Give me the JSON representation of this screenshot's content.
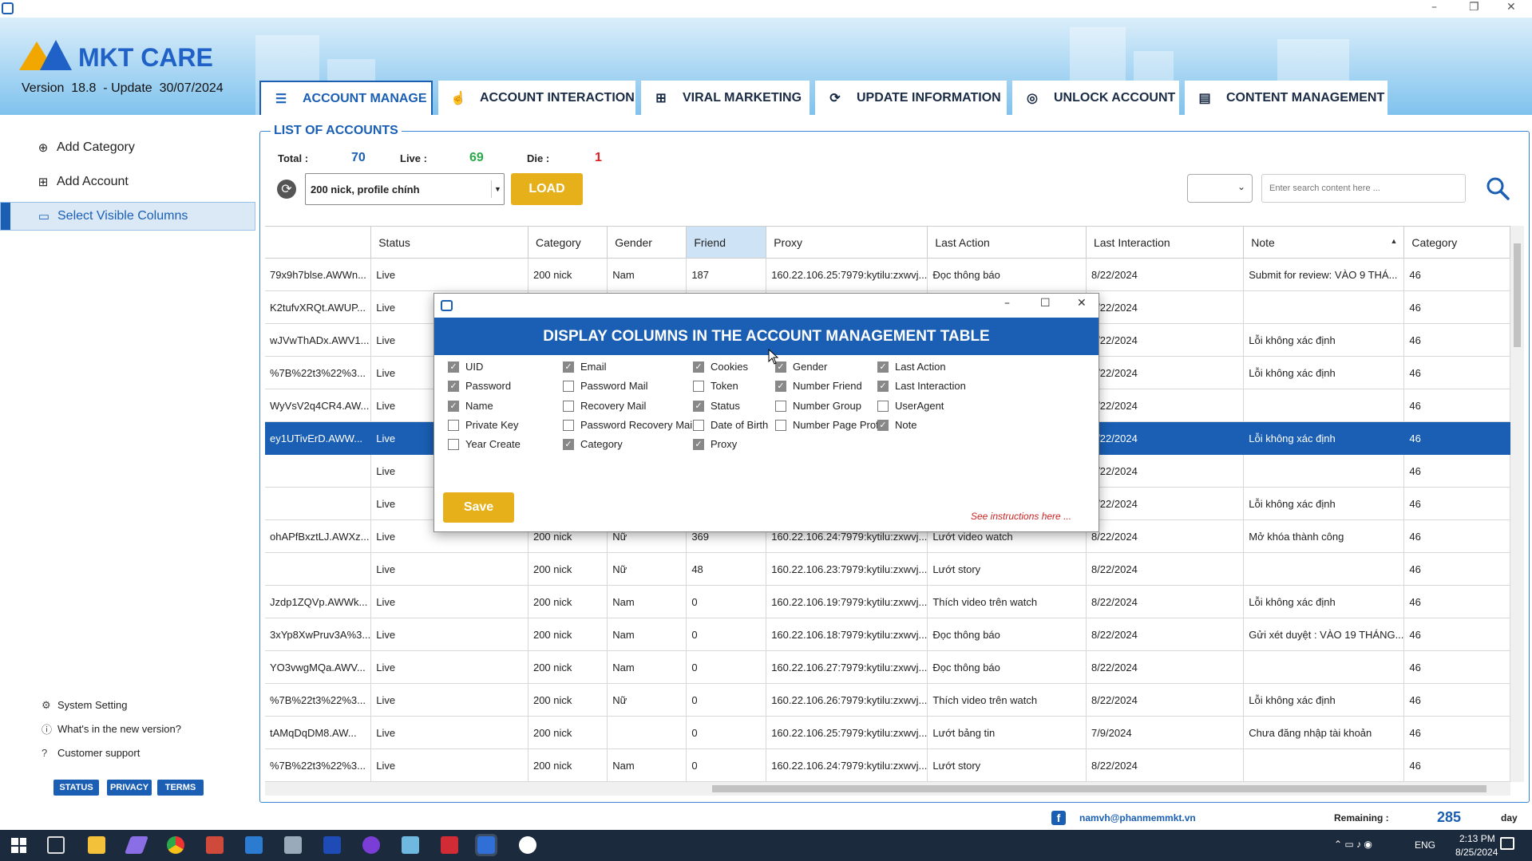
{
  "window": {
    "minimize": "–",
    "maximize": "❐",
    "close": "✕"
  },
  "brand": {
    "name": "MKT CARE",
    "version_label": "Version",
    "version": "18.8",
    "update_label": "- Update",
    "update_date": "30/07/2024"
  },
  "tabs": [
    {
      "label": "ACCOUNT MANAGE",
      "icon": "list-icon",
      "glyph": "☰"
    },
    {
      "label": "ACCOUNT INTERACTION",
      "icon": "hand-pointer-icon",
      "glyph": "☝"
    },
    {
      "label": "VIRAL MARKETING",
      "icon": "grid-icon",
      "glyph": "⊞"
    },
    {
      "label": "UPDATE INFORMATION",
      "icon": "refresh-check-icon",
      "glyph": "⟳"
    },
    {
      "label": "UNLOCK ACCOUNT",
      "icon": "fingerprint-icon",
      "glyph": "◎"
    },
    {
      "label": "CONTENT MANAGEMENT",
      "icon": "document-icon",
      "glyph": "▤"
    }
  ],
  "sidebar": {
    "items": [
      {
        "label": "Add Category",
        "icon": "add-category-icon",
        "glyph": "⊕"
      },
      {
        "label": "Add Account",
        "icon": "add-account-icon",
        "glyph": "⊞"
      },
      {
        "label": "Select Visible Columns",
        "icon": "monitor-icon",
        "glyph": "▭"
      }
    ],
    "links": [
      {
        "label": "System Setting",
        "icon": "gear-icon",
        "glyph": "⚙"
      },
      {
        "label": "What's in the new version?",
        "icon": "info-icon",
        "glyph": "ⓘ"
      },
      {
        "label": "Customer support",
        "icon": "help-icon",
        "glyph": "?"
      }
    ],
    "badges": [
      "STATUS",
      "PRIVACY",
      "TERMS"
    ]
  },
  "panel": {
    "title": "LIST OF ACCOUNTS",
    "total_label": "Total :",
    "total": "70",
    "live_label": "Live :",
    "live": "69",
    "die_label": "Die :",
    "die": "1",
    "combo_value": "200 nick, profile chính",
    "load_label": "LOAD",
    "search_placeholder": "Enter search content here ..."
  },
  "table": {
    "columns": [
      "",
      "Status",
      "Category",
      "Gender",
      "Friend",
      "Proxy",
      "Last Action",
      "Last Interaction",
      "Note",
      "Category"
    ],
    "rows": [
      [
        "79x9h7blse.AWWn...",
        "Live",
        "200 nick",
        "Nam",
        "187",
        "160.22.106.25:7979:kytilu:zxwvj...",
        "Đọc thông báo",
        "8/22/2024",
        "Submit for review: VÀO 9 THÁ...",
        "46"
      ],
      [
        "K2tufvXRQt.AWUP...",
        "Live",
        "",
        "",
        "",
        "",
        "",
        "8/22/2024",
        "",
        "46"
      ],
      [
        "wJVwThADx.AWV1...",
        "Live",
        "",
        "",
        "",
        "",
        "",
        "8/22/2024",
        "Lỗi không xác định",
        "46"
      ],
      [
        "%7B%22t3%22%3...",
        "Live",
        "",
        "",
        "",
        "",
        "",
        "8/22/2024",
        "Lỗi không xác định",
        "46"
      ],
      [
        "WyVsV2q4CR4.AW...",
        "Live",
        "",
        "",
        "",
        "",
        "",
        "8/22/2024",
        "",
        "46"
      ],
      [
        "ey1UTivErD.AWW...",
        "Live",
        "",
        "",
        "",
        "",
        "",
        "8/22/2024",
        "Lỗi không xác định",
        "46"
      ],
      [
        "",
        "Live",
        "",
        "",
        "",
        "",
        "",
        "8/22/2024",
        "",
        "46"
      ],
      [
        "",
        "Live",
        "",
        "",
        "",
        "",
        "",
        "8/22/2024",
        "Lỗi không xác định",
        "46"
      ],
      [
        "ohAPfBxztLJ.AWXz...",
        "Live",
        "200 nick",
        "Nữ",
        "369",
        "160.22.106.24:7979:kytilu:zxwvj...",
        "Lướt video watch",
        "8/22/2024",
        "Mở khóa thành công",
        "46"
      ],
      [
        "",
        "Live",
        "200 nick",
        "Nữ",
        "48",
        "160.22.106.23:7979:kytilu:zxwvj...",
        "Lướt story",
        "8/22/2024",
        "",
        "46"
      ],
      [
        "Jzdp1ZQVp.AWWk...",
        "Live",
        "200 nick",
        "Nam",
        "0",
        "160.22.106.19:7979:kytilu:zxwvj...",
        "Thích video trên watch",
        "8/22/2024",
        "Lỗi không xác định",
        "46"
      ],
      [
        "3xYp8XwPruv3A%3...",
        "Live",
        "200 nick",
        "Nam",
        "0",
        "160.22.106.18:7979:kytilu:zxwvj...",
        "Đọc thông báo",
        "8/22/2024",
        "Gửi xét duyệt : VÀO 19 THÁNG...",
        "46"
      ],
      [
        "YO3vwgMQa.AWV...",
        "Live",
        "200 nick",
        "Nam",
        "0",
        "160.22.106.27:7979:kytilu:zxwvj...",
        "Đọc thông báo",
        "8/22/2024",
        "",
        "46"
      ],
      [
        "%7B%22t3%22%3...",
        "Live",
        "200 nick",
        "Nữ",
        "0",
        "160.22.106.26:7979:kytilu:zxwvj...",
        "Thích video trên watch",
        "8/22/2024",
        "Lỗi không xác định",
        "46"
      ],
      [
        "tAMqDqDM8.AW...",
        "Live",
        "200 nick",
        "",
        "0",
        "160.22.106.25:7979:kytilu:zxwvj...",
        "Lướt bảng tin",
        "7/9/2024",
        "Chưa đăng nhập tài khoản",
        "46"
      ],
      [
        "%7B%22t3%22%3...",
        "Live",
        "200 nick",
        "Nam",
        "0",
        "160.22.106.24:7979:kytilu:zxwvj...",
        "Lướt story",
        "8/22/2024",
        "",
        "46"
      ]
    ],
    "selected_row": 5
  },
  "dialog": {
    "title": "DISPLAY COLUMNS IN THE ACCOUNT MANAGEMENT TABLE",
    "columns": [
      [
        {
          "label": "UID",
          "checked": true
        },
        {
          "label": "Password",
          "checked": true
        },
        {
          "label": "Name",
          "checked": true
        },
        {
          "label": "Private Key",
          "checked": false
        },
        {
          "label": "Year Create",
          "checked": false
        }
      ],
      [
        {
          "label": "Email",
          "checked": true
        },
        {
          "label": "Password Mail",
          "checked": false
        },
        {
          "label": "Recovery Mail",
          "checked": false
        },
        {
          "label": "Password Recovery Mail",
          "checked": false
        },
        {
          "label": "Category",
          "checked": true
        }
      ],
      [
        {
          "label": "Cookies",
          "checked": true
        },
        {
          "label": "Token",
          "checked": false
        },
        {
          "label": "Status",
          "checked": true
        },
        {
          "label": "Date of Birth",
          "checked": false
        },
        {
          "label": "Proxy",
          "checked": true
        }
      ],
      [
        {
          "label": "Gender",
          "checked": true
        },
        {
          "label": "Number Friend",
          "checked": true
        },
        {
          "label": "Number Group",
          "checked": false
        },
        {
          "label": "Number Page Profi",
          "checked": false
        }
      ],
      [
        {
          "label": "Last Action",
          "checked": true
        },
        {
          "label": "Last Interaction",
          "checked": true
        },
        {
          "label": "UserAgent",
          "checked": false
        },
        {
          "label": "Note",
          "checked": true
        }
      ]
    ],
    "save_label": "Save",
    "instructions": "See instructions here ..."
  },
  "footer": {
    "email": "namvh@phanmemmkt.vn",
    "remaining_label": "Remaining :",
    "remaining": "285",
    "day_label": "day"
  },
  "taskbar": {
    "lang": "ENG",
    "time": "2:13 PM",
    "date": "8/25/2024"
  },
  "colors": {
    "accent": "#1a5fb4",
    "button": "#e5b01a",
    "live": "#2aa84a",
    "die": "#e02020"
  }
}
